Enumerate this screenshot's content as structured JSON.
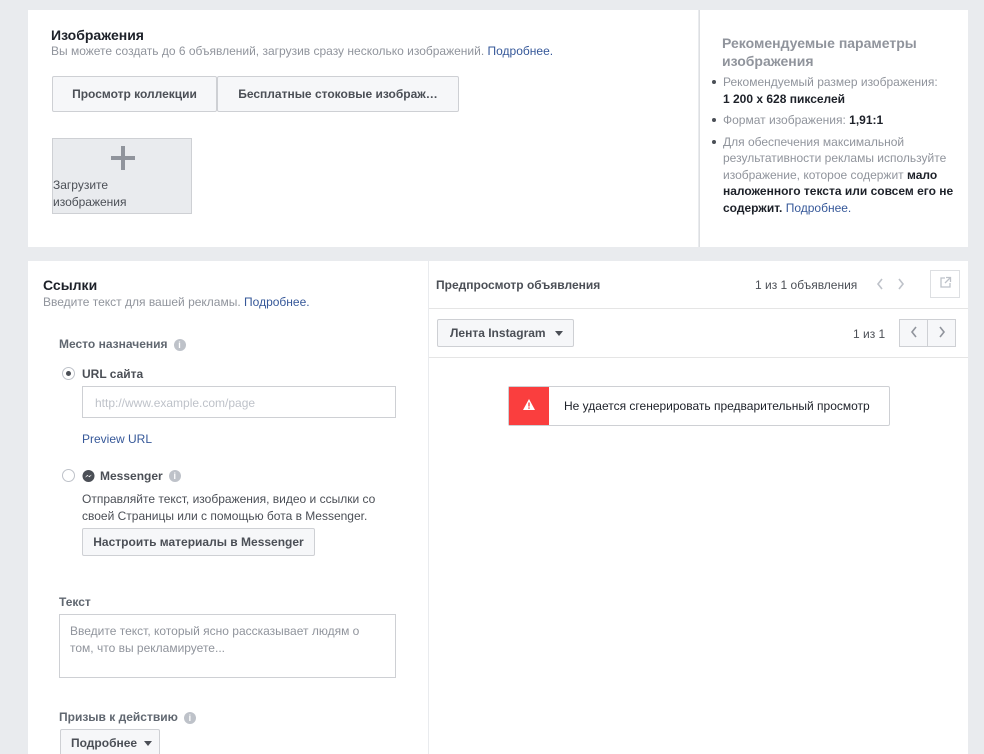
{
  "images": {
    "title": "Изображения",
    "description": "Вы можете создать до 6 объявлений, загрузив сразу несколько изображений.",
    "more_link": "Подробнее.",
    "browse_button": "Просмотр коллекции",
    "stock_button": "Бесплатные стоковые изображ…",
    "upload_line1": "Загрузите",
    "upload_line2": "изображения"
  },
  "recommendations": {
    "title": "Рекомендуемые параметры изображения",
    "size_label": "Рекомендуемый размер изображения:",
    "size_value": "1 200 x 628 пикселей",
    "format_label": "Формат изображения:",
    "format_value": "1,91:1",
    "text_tip_part1": "Для обеспечения максимальной результативности рекламы используйте изображение, которое содержит",
    "text_tip_bold": "мало наложенного текста или совсем его не содержит.",
    "more_link": "Подробнее."
  },
  "links": {
    "title": "Ссылки",
    "description": "Введите текст для вашей рекламы.",
    "more_link": "Подробнее.",
    "destination_label": "Место назначения",
    "url_option": "URL сайта",
    "url_placeholder": "http://www.example.com/page",
    "preview_url": "Preview URL",
    "messenger_option": "Messenger",
    "messenger_description": "Отправляйте текст, изображения, видео и ссылки со своей Страницы или с помощью бота в Messenger.",
    "messenger_setup_button": "Настроить материалы в Messenger",
    "text_label": "Текст",
    "text_placeholder": "Введите текст, который ясно рассказывает людям о том, что вы рекламируете...",
    "cta_label": "Призыв к действию",
    "cta_value": "Подробнее"
  },
  "preview": {
    "title": "Предпросмотр объявления",
    "ad_counter": "1 из 1 объявления",
    "placement": "Лента Instagram",
    "page_counter": "1 из 1",
    "error": "Не удается сгенерировать предварительный просмотр"
  },
  "colors": {
    "link": "#365899",
    "error": "#fa3e3e",
    "background": "#e9ebee"
  }
}
